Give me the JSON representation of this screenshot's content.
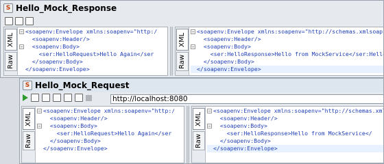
{
  "mock_response_window": {
    "title": "Hello_Mock_Response",
    "request_tabs": [
      "XML",
      "Raw"
    ],
    "response_tabs": [
      "XML",
      "Raw"
    ],
    "request_xml": [
      "<soapenv:Envelope xmlns:soapenv=\"http:/",
      "  <soapenv:Header/>",
      "  <soapenv:Body>",
      "    <ser:HelloRequest>Hello Again</ser",
      "  </soapenv:Body>",
      "</soapenv:Envelope>"
    ],
    "response_xml": [
      "<soapenv:Envelope xmlns:soapenv=\"http://schemas.xmlsoap.org",
      "  <soapenv:Header/>",
      "  <soapenv:Body>",
      "    <ser:HelloResponse>Hello from MockService</ser:HelloRes",
      "  </soapenv:Body>",
      "</soapenv:Envelope>"
    ]
  },
  "mock_request_window": {
    "title": "Hello_Mock_Request",
    "endpoint_url": "http://localhost:8080",
    "request_tabs": [
      "XML",
      "Raw"
    ],
    "response_tabs": [
      "XML",
      "Raw"
    ],
    "request_xml": [
      "<soapenv:Envelope xmlns:soapenv=\"http:/",
      "  <soapenv:Header/>",
      "  <soapenv:Body>",
      "    <ser:HelloRequest>Hello Again</ser",
      "  </soapenv:Body>",
      "</soapenv:Envelope>"
    ],
    "response_xml": [
      "<soapenv:Envelope xmlns:soapenv=\"http://schemas.xmlso",
      "  <soapenv:Header/>",
      "  <soapenv:Body>",
      "    <ser:HelloResponse>Hello from MockService</",
      "  </soapenv:Body>",
      "</soapenv:Envelope>"
    ]
  },
  "colors": {
    "tag": "#1f3fb5",
    "attribute": "#7a7a7a",
    "run_button": "#2e9b2e"
  },
  "icons": [
    "soap-window-icon",
    "play-icon",
    "stop-icon",
    "options-icon"
  ]
}
